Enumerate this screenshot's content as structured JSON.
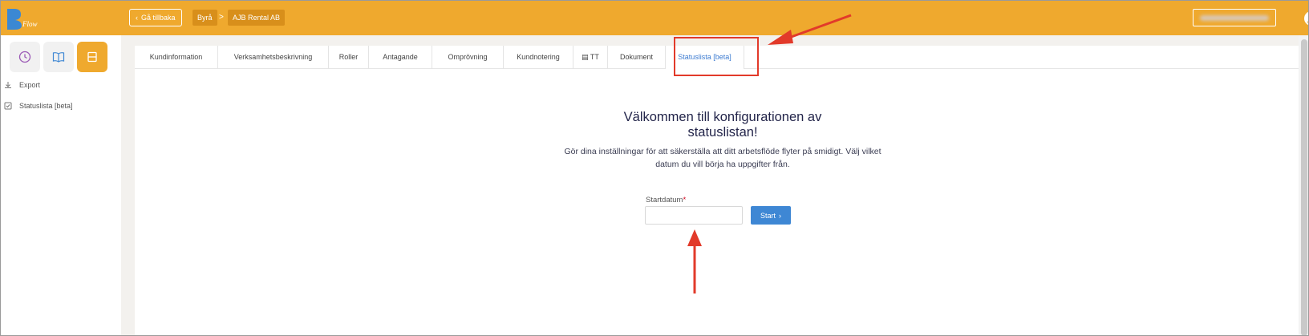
{
  "header": {
    "back_label": "Gå tillbaka",
    "breadcrumbs": [
      "Byrå",
      "AJB Rental AB"
    ],
    "separator": ">"
  },
  "sidebar": {
    "icons": [
      "clock-icon",
      "book-icon",
      "layout-icon"
    ],
    "links": [
      {
        "label": "Export",
        "icon": "download-icon"
      },
      {
        "label": "Statuslista [beta]",
        "icon": "checkbox-icon"
      }
    ]
  },
  "tabs": [
    {
      "label": "Kundinformation"
    },
    {
      "label": "Verksamhetsbeskrivning"
    },
    {
      "label": "Roller"
    },
    {
      "label": "Antagande"
    },
    {
      "label": "Omprövning"
    },
    {
      "label": "Kundnotering"
    },
    {
      "label": "TT",
      "icon": "printer-icon"
    },
    {
      "label": "Dokument"
    },
    {
      "label": "Statuslista [beta]",
      "active": true
    }
  ],
  "main": {
    "title": "Välkommen till konfigurationen av statuslistan!",
    "subtitle": "Gör dina inställningar för att säkerställa att ditt arbetsflöde flyter på smidigt. Välj vilket datum du vill börja ha uppgifter från.",
    "start_label": "Startdatum",
    "required_marker": "*",
    "start_value": "",
    "start_button": "Start"
  },
  "colors": {
    "brand": "#efa92e",
    "accent": "#3e87d4",
    "annotation": "#e23a2a"
  }
}
